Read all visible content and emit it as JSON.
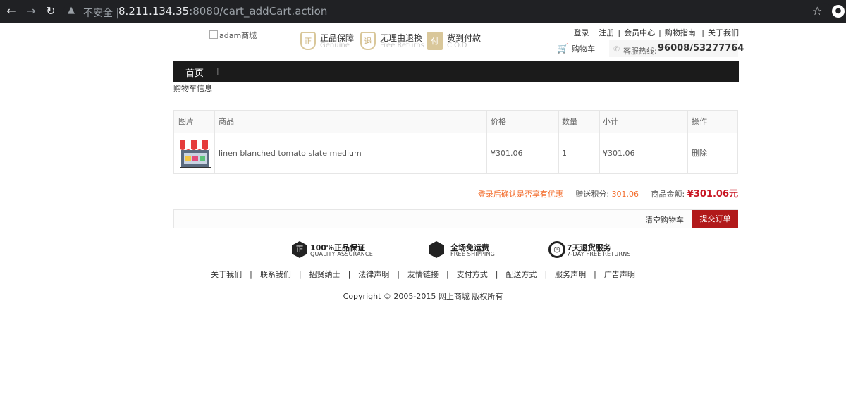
{
  "browser": {
    "insecure_label": "不安全",
    "url_host": "8.211.134.35",
    "url_rest": ":8080/cart_addCart.action"
  },
  "header": {
    "logo_alt": "adam商城",
    "badges": [
      {
        "title": "正品保障",
        "sub": "Genuine",
        "icon": "正"
      },
      {
        "title": "无理由退换",
        "sub": "Free Returns",
        "icon": "退"
      },
      {
        "title": "货到付款",
        "sub": "C.O.D",
        "icon": "付"
      }
    ],
    "links": [
      "登录",
      "注册",
      "会员中心",
      "购物指南",
      "关于我们"
    ],
    "cart_label": "购物车",
    "hotline_label": "客服热线:",
    "hotline_number": "96008/53277764"
  },
  "nav": {
    "home": "首页",
    "bar": "|"
  },
  "cart": {
    "title": "购物车信息",
    "headers": [
      "图片",
      "商品",
      "价格",
      "数量",
      "小计",
      "操作"
    ],
    "items": [
      {
        "name": "linen blanched tomato slate medium",
        "price": "¥301.06",
        "qty": "1",
        "subtotal": "¥301.06",
        "action": "删除"
      }
    ],
    "promo": "登录后确认是否享有优惠",
    "points_label": "赠送积分:",
    "points": "301.06",
    "total_label": "商品金额:",
    "total": "¥301.06元",
    "clear": "清空购物车",
    "submit": "提交订单"
  },
  "services": [
    {
      "title": "100%正品保证",
      "sub": "QUALITY ASSURANCE",
      "icon": "正"
    },
    {
      "title": "全场免运费",
      "sub": "FREE SHIPPING",
      "icon": ""
    },
    {
      "title": "7天退货服务",
      "sub": "7-DAY FREE RETURNS",
      "icon": ""
    }
  ],
  "footer": {
    "links": [
      "关于我们",
      "联系我们",
      "招贤纳士",
      "法律声明",
      "友情链接",
      "支付方式",
      "配送方式",
      "服务声明",
      "广告声明"
    ],
    "copyright": "Copyright © 2005-2015 网上商城 版权所有"
  },
  "colors": {
    "accent_red": "#b1191a",
    "price_red": "#c81623",
    "promo_orange": "#f36d2c"
  }
}
